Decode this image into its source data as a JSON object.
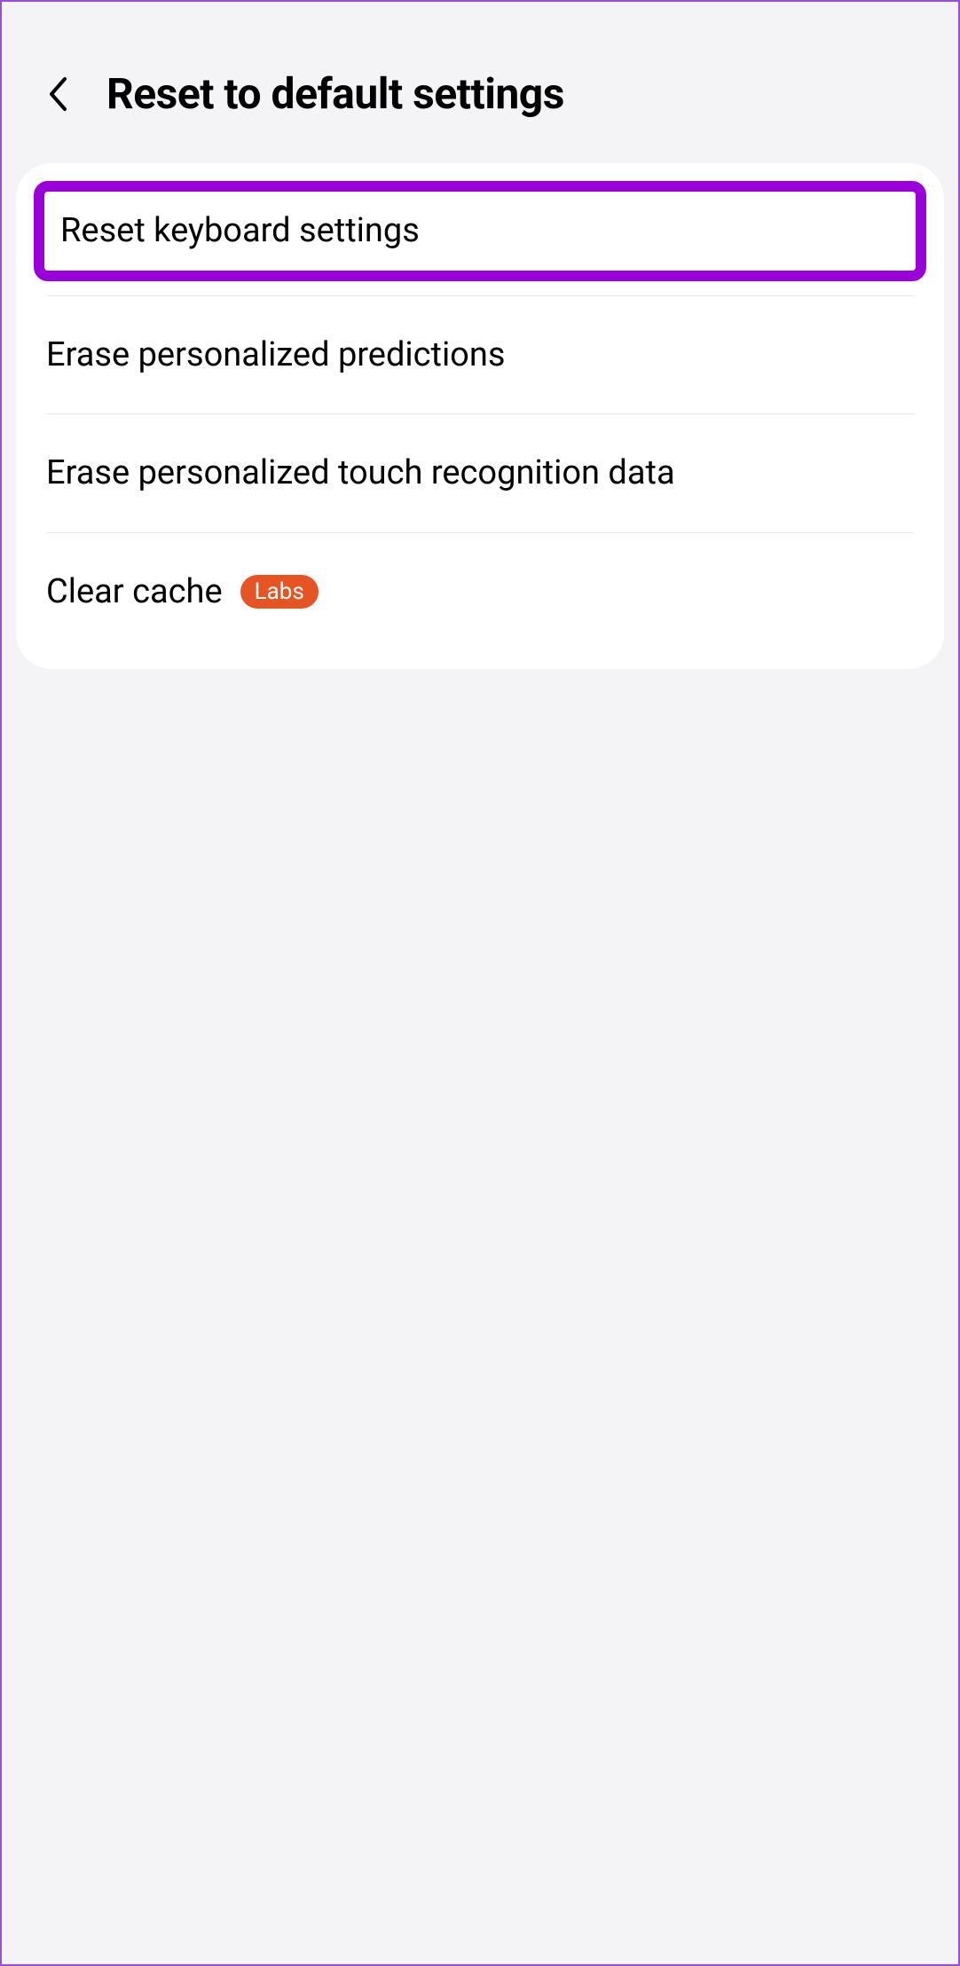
{
  "header": {
    "title": "Reset to default settings"
  },
  "items": {
    "reset_keyboard": "Reset keyboard settings",
    "erase_predictions": "Erase personalized predictions",
    "erase_touch": "Erase personalized touch recognition data",
    "clear_cache": "Clear cache",
    "clear_cache_badge": "Labs"
  }
}
